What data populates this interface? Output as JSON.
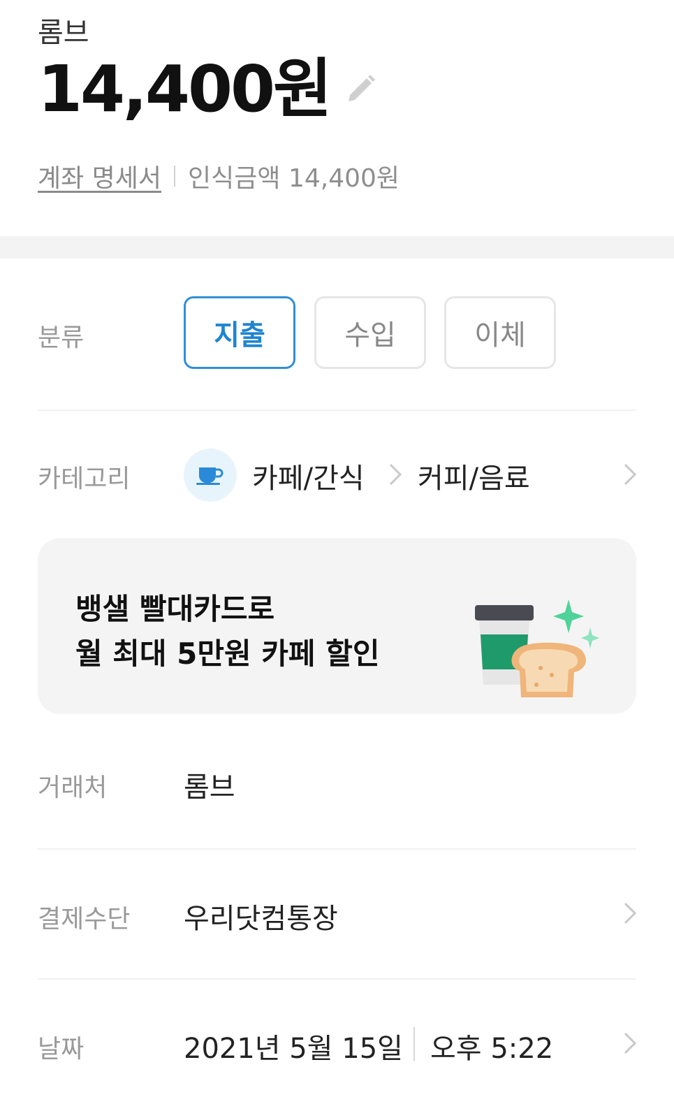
{
  "header": {
    "merchant": "롬브",
    "amount": "14,400원",
    "statement_link": "계좌 명세서",
    "recognized_amount": "인식금액 14,400원"
  },
  "type_row": {
    "label": "분류",
    "options": [
      "지출",
      "수입",
      "이체"
    ],
    "selected": "지출"
  },
  "category_row": {
    "label": "카테고리",
    "icon": "coffee-cup-icon",
    "category": "카페/간식",
    "subcategory": "커피/음료"
  },
  "banner": {
    "line1": "뱅샐 빨대카드로",
    "line2": "월 최대 5만원 카페 할인"
  },
  "merchant_row": {
    "label": "거래처",
    "value": "롬브"
  },
  "payment_row": {
    "label": "결제수단",
    "value": "우리닷컴통장"
  },
  "date_row": {
    "label": "날짜",
    "date": "2021년 5월 15일",
    "time": "오후 5:22"
  },
  "colors": {
    "accent": "#2f8fd6",
    "band": "#f3f3f3",
    "banner_bg": "#f4f4f4",
    "label": "#999999"
  }
}
